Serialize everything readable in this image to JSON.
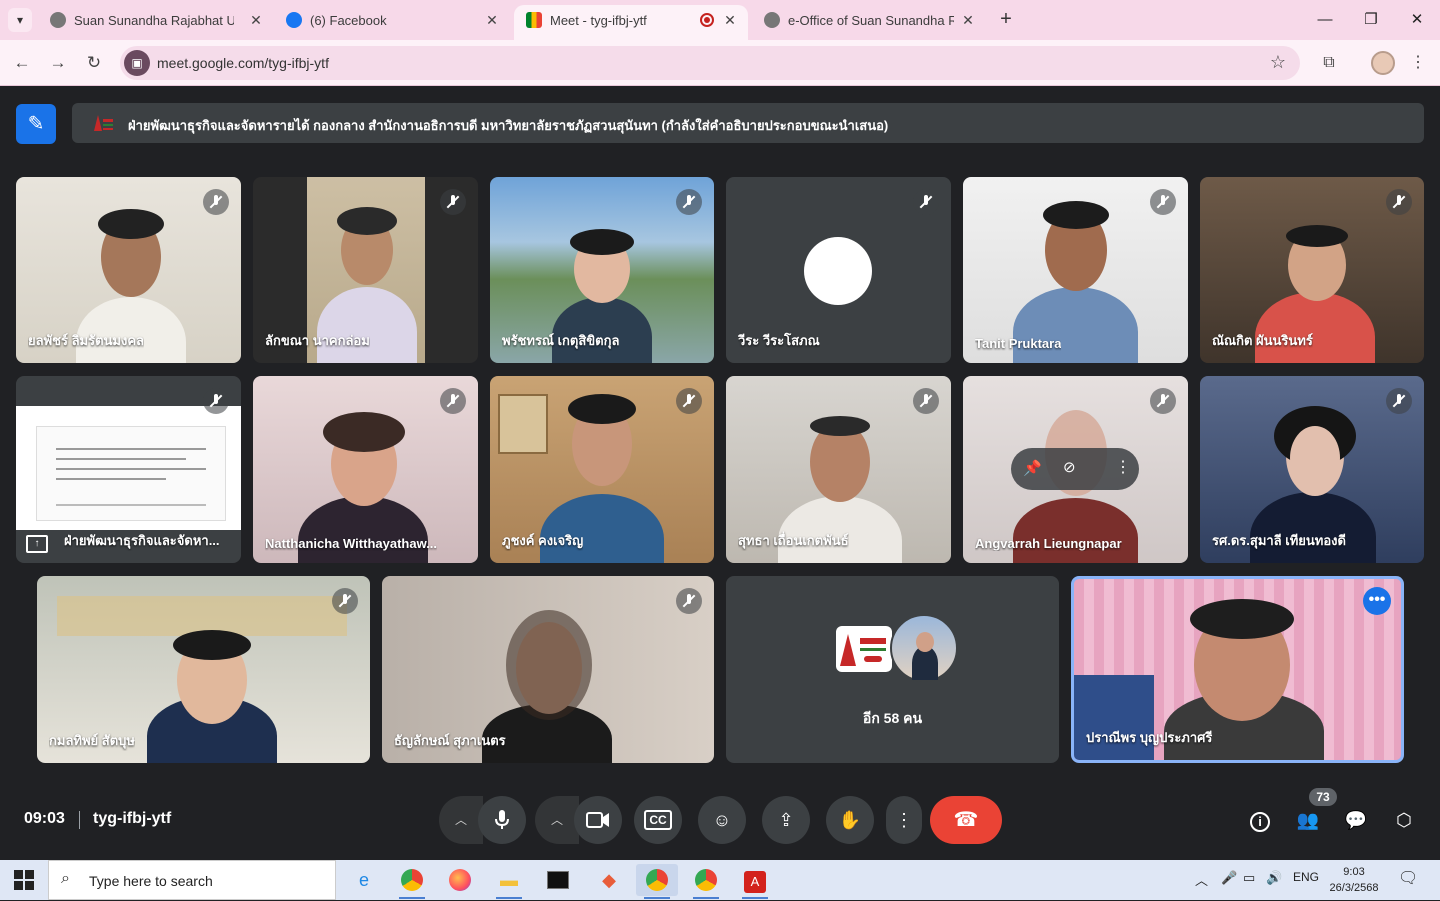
{
  "browser": {
    "tabs": [
      {
        "title": "Suan Sunandha Rajabhat Unive",
        "icon": "globe-icon"
      },
      {
        "title": "(6) Facebook",
        "icon": "facebook-icon"
      },
      {
        "title": "Meet - tyg-ifbj-ytf",
        "icon": "meet-icon",
        "active": true,
        "recording": true
      },
      {
        "title": "e-Office of Suan Sunandha Raja",
        "icon": "globe-icon"
      }
    ],
    "url": "meet.google.com/tyg-ifbj-ytf"
  },
  "meet": {
    "presentation_banner": "ฝ่ายพัฒนาธุรกิจและจัดหารายได้ กองกลาง สำนักงานอธิการบดี มหาวิทยาลัยราชภัฏสวนสุนันทา (กำลังใส่คำอธิบายประกอบขณะนำเสนอ)",
    "participants": [
      {
        "name": "ยลพัชร์ ลิมรัตนมงคล"
      },
      {
        "name": "ลักขณา นาคกล่อม"
      },
      {
        "name": "พรัชทรณ์ เกตุสิขิตกุล"
      },
      {
        "name": "วีระ วีระโสภณ"
      },
      {
        "name": "Tanit Pruktara"
      },
      {
        "name": "ณัณกิต ผันนรินทร์"
      },
      {
        "name": "ฝ่ายพัฒนาธุรกิจและจัดหา..."
      },
      {
        "name": "Natthanicha Witthayathaw..."
      },
      {
        "name": "ภูชงค์ คงเจริญ"
      },
      {
        "name": "สุทธา เถื่อนเกตพันธ์"
      },
      {
        "name": "Angvarrah Lieungnapar"
      },
      {
        "name": "รศ.ดร.สุมาลี เทียนทองดี"
      },
      {
        "name": "กมลทิพย์ สัตบุษ"
      },
      {
        "name": "ธัญลักษณ์ สุภาเนตร"
      },
      {
        "name": "ปราณีพร บุญประภาศรี"
      }
    ],
    "more_label": "อีก 58 คน",
    "clock": "09:03",
    "meeting_code": "tyg-ifbj-ytf",
    "participant_count": "73"
  },
  "taskbar": {
    "search_placeholder": "Type here to search",
    "language": "ENG",
    "time": "9:03",
    "date": "26/3/2568"
  }
}
